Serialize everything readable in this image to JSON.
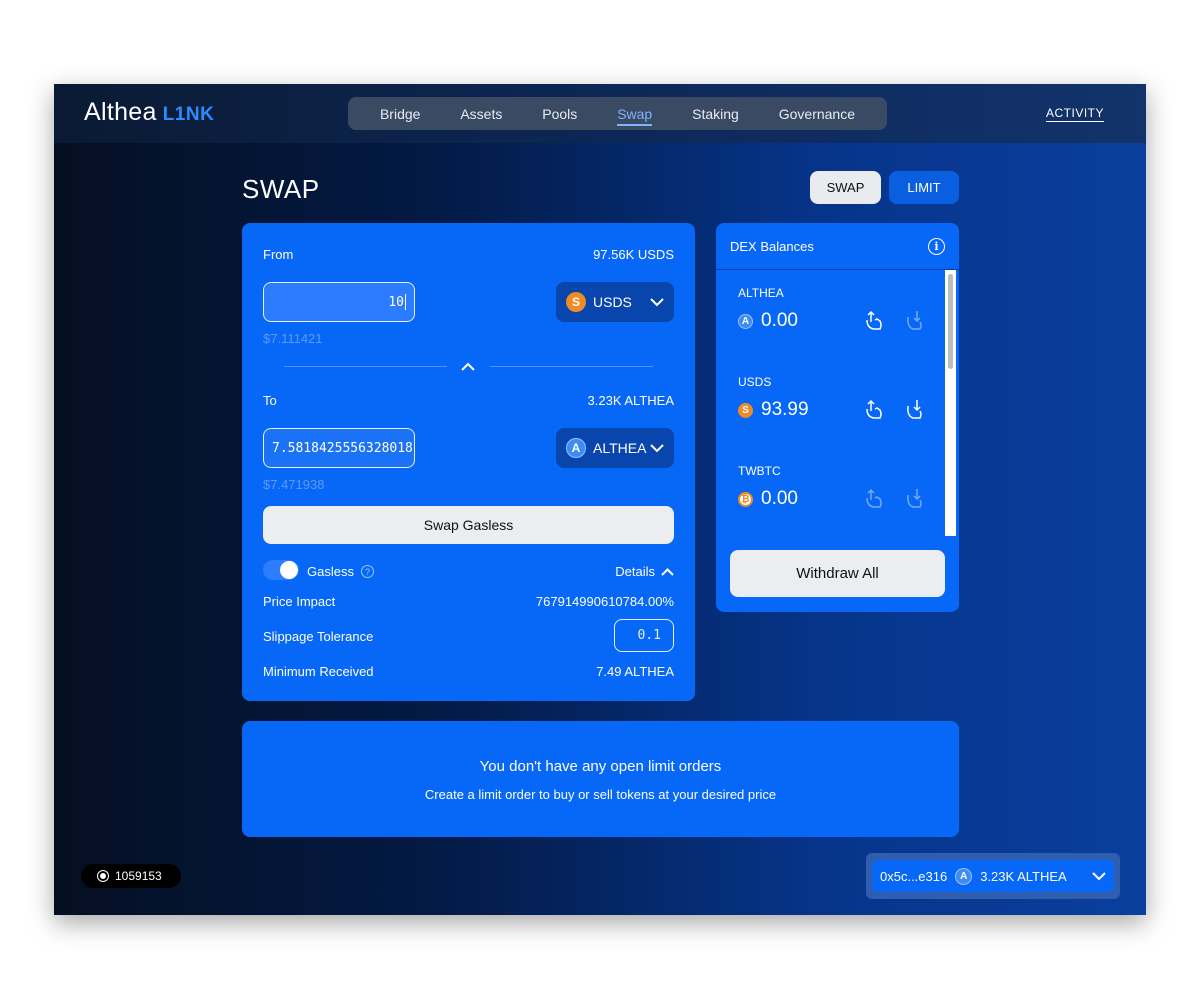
{
  "header": {
    "logo_main": "Althea",
    "logo_accent": "L1NK",
    "nav": [
      "Bridge",
      "Assets",
      "Pools",
      "Swap",
      "Staking",
      "Governance"
    ],
    "nav_active": "Swap",
    "activity_label": "ACTIVITY"
  },
  "page": {
    "title": "SWAP",
    "mode_swap": "SWAP",
    "mode_limit": "LIMIT"
  },
  "swap": {
    "from_label": "From",
    "from_balance": "97.56K USDS",
    "from_amount": "10",
    "from_token": "USDS",
    "from_usd": "$7.111421",
    "to_label": "To",
    "to_balance": "3.23K ALTHEA",
    "to_amount": "7.5818425556328018",
    "to_token": "ALTHEA",
    "to_usd": "$7.471938",
    "submit_label": "Swap Gasless",
    "gasless_label": "Gasless",
    "gasless_enabled": true,
    "details_label": "Details",
    "price_impact_label": "Price Impact",
    "price_impact_value": "767914990610784.00%",
    "slippage_label": "Slippage Tolerance",
    "slippage_value": "0.1",
    "min_received_label": "Minimum Received",
    "min_received_value": "7.49 ALTHEA"
  },
  "dex": {
    "title": "DEX Balances",
    "items": [
      {
        "symbol": "ALTHEA",
        "balance": "0.00",
        "icon": "althea-coin-icon"
      },
      {
        "symbol": "USDS",
        "balance": "93.99",
        "icon": "usds-coin-icon"
      },
      {
        "symbol": "TWBTC",
        "balance": "0.00",
        "icon": "btc-coin-icon"
      }
    ],
    "withdraw_label": "Withdraw All"
  },
  "orders": {
    "empty_title": "You don't have any open limit orders",
    "empty_subtitle": "Create a limit order to buy or sell tokens at your desired price"
  },
  "footer": {
    "block_number": "1059153",
    "wallet_address": "0x5c...e316",
    "wallet_balance": "3.23K ALTHEA"
  },
  "colors": {
    "card": "#0767f7",
    "accent": "#2b8cff",
    "nav_bg": "#3a4a63"
  }
}
